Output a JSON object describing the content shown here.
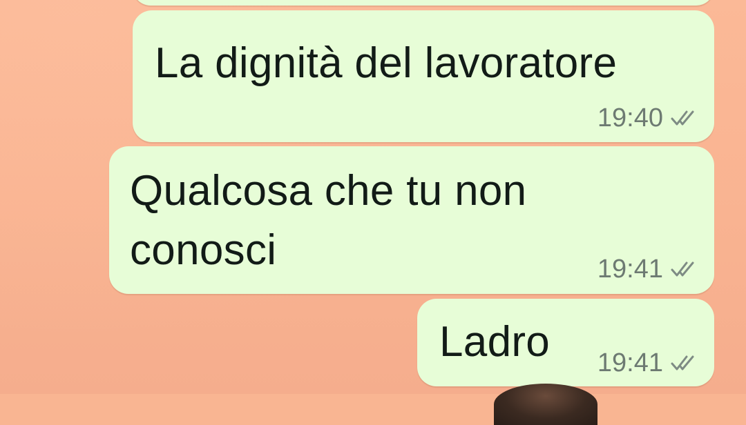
{
  "conversation": {
    "messages": [
      {
        "text": "La dignità del lavoratore",
        "time": "19:40",
        "status_icon": "double-check-icon"
      },
      {
        "text_lines": [
          "Qualcosa che tu non",
          "conosci"
        ],
        "time": "19:41",
        "status_icon": "double-check-icon"
      },
      {
        "text": "Ladro",
        "time": "19:41",
        "status_icon": "double-check-icon"
      }
    ]
  },
  "colors": {
    "background": "#f9b592",
    "outgoing_bubble": "#e7fdd7",
    "message_text": "#121b17",
    "meta_text": "#6d7a72"
  }
}
